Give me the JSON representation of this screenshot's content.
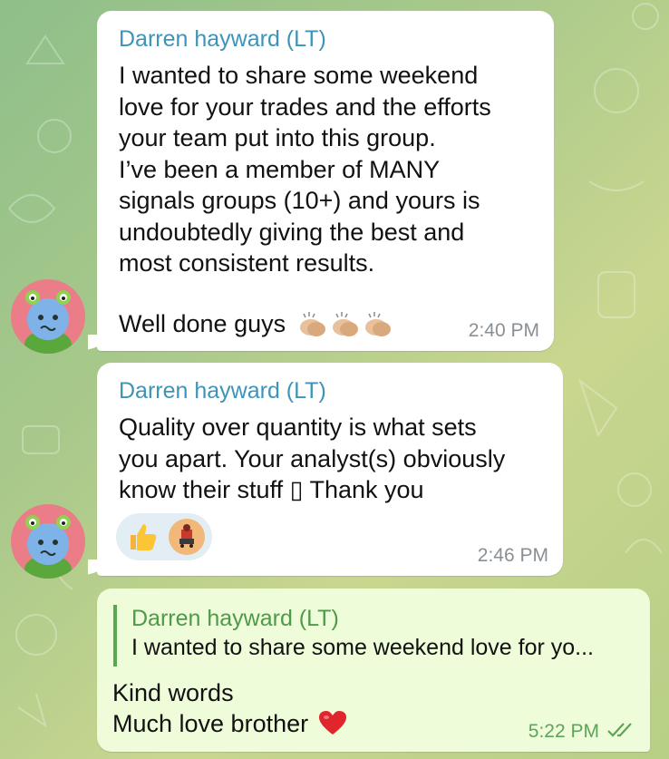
{
  "colors": {
    "sender_name": "#3d94b8",
    "reply_accent": "#57a850",
    "outgoing_bubble": "#eefcd9",
    "incoming_bubble": "#ffffff",
    "heart": "#e0252d"
  },
  "messages": [
    {
      "sender": "Darren hayward (LT)",
      "text": "I wanted to share some weekend\nlove for your trades and the efforts\nyour team put into this group.\nI’ve been a member of MANY\nsignals groups (10+) and yours is\nundoubtedly giving the best and\nmost consistent results.",
      "closing": "Well done guys",
      "emoji": [
        "clapping-hands",
        "clapping-hands",
        "clapping-hands"
      ],
      "time": "2:40 PM"
    },
    {
      "sender": "Darren hayward (LT)",
      "text": "Quality over quantity is what sets\nyou apart. Your analyst(s) obviously\nknow their stuff ▯ Thank you",
      "reactions": [
        "thumbs-up",
        "reactor-avatar"
      ],
      "time": "2:46 PM"
    },
    {
      "reply_to": {
        "sender": "Darren hayward (LT)",
        "snippet": "I wanted to share some weekend love for yo..."
      },
      "line1": "Kind words",
      "line2": "Much love brother",
      "emoji": "red-heart",
      "time": "5:22 PM",
      "status": "read"
    }
  ]
}
